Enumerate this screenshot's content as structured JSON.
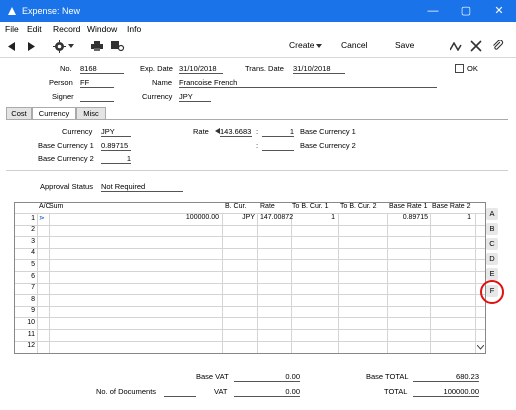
{
  "window": {
    "title": "Expense: New"
  },
  "menu": [
    "File",
    "Edit",
    "Record",
    "Window",
    "Info"
  ],
  "toolbar": {
    "create": "Create",
    "cancel": "Cancel",
    "save": "Save"
  },
  "header": {
    "no_label": "No.",
    "no_value": "8168",
    "exp_date_label": "Exp. Date",
    "exp_date_value": "31/10/2018",
    "trans_date_label": "Trans. Date",
    "trans_date_value": "31/10/2018",
    "ok_label": "OK",
    "person_label": "Person",
    "person_value": "FF",
    "name_label": "Name",
    "name_value": "Francoise French",
    "signer_label": "Signer",
    "signer_value": "",
    "currency_label": "Currency",
    "currency_value": "JPY"
  },
  "tabs": [
    "Cost",
    "Currency",
    "Misc"
  ],
  "currency_tab": {
    "currency_label": "Currency",
    "currency_value": "JPY",
    "rate_label": "Rate",
    "rate_value": "143.6683",
    "rate_base_value": "1",
    "base_currency_1_text": "Base Currency 1",
    "base_currency_1_label": "Base Currency 1",
    "base_currency_1_value": "0.89715",
    "base_currency_2_text": "Base Currency 2",
    "base_currency_2_label": "Base Currency 2",
    "base_currency_2_value": "1",
    "colon": ":"
  },
  "approval": {
    "label": "Approval Status",
    "value": "Not Required"
  },
  "grid": {
    "columns": [
      "A/C",
      "Sum",
      "B. Cur.",
      "Rate",
      "To B. Cur. 1",
      "To B. Cur. 2",
      "Base Rate 1",
      "Base Rate 2"
    ],
    "row_numbers": [
      "1",
      "2",
      "3",
      "4",
      "5",
      "6",
      "7",
      "8",
      "9",
      "10",
      "11",
      "12"
    ],
    "row1": {
      "ac": "⋗",
      "sum": "100000.00",
      "bcur": "JPY",
      "rate": "147.00872",
      "to1": "1",
      "br1": "0.89715",
      "br2": "1"
    },
    "side_labels": [
      "A",
      "B",
      "C",
      "D",
      "E",
      "F"
    ]
  },
  "footer": {
    "base_vat_label": "Base VAT",
    "base_vat_value": "0.00",
    "base_total_label": "Base TOTAL",
    "base_total_value": "680.23",
    "docs_label": "No. of Documents",
    "docs_value": "",
    "vat_label": "VAT",
    "vat_value": "0.00",
    "total_label": "TOTAL",
    "total_value": "100000.00"
  },
  "colors": {
    "titlebar": "#1a73e8",
    "highlight": "#e01010"
  }
}
